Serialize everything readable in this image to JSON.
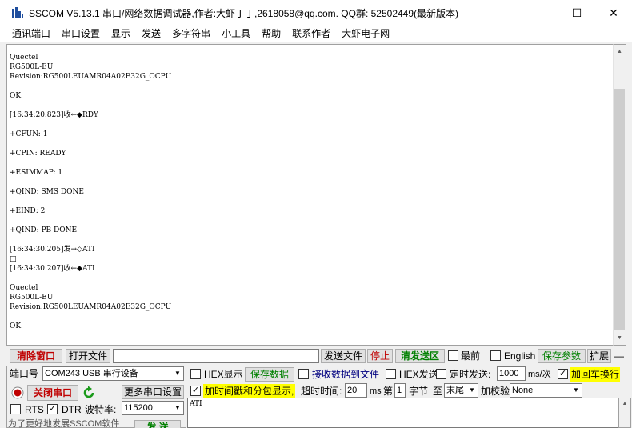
{
  "window": {
    "title": "SSCOM V5.13.1 串口/网络数据调试器,作者:大虾丁丁,2618058@qq.com. QQ群: 52502449(最新版本)",
    "minimize": "—",
    "maximize": "☐",
    "close": "✕"
  },
  "menu": [
    "通讯端口",
    "串口设置",
    "显示",
    "发送",
    "多字符串",
    "小工具",
    "帮助",
    "联系作者",
    "大虾电子网"
  ],
  "receive": {
    "lines": [
      "Quectel",
      "RG500L-EU",
      "Revision:RG500LEUAMR04A02E32G_OCPU",
      "",
      "OK",
      "",
      "[16:34:20.823]收←◆RDY",
      "",
      "+CFUN: 1",
      "",
      "+CPIN: READY",
      "",
      "+ESIMMAP: 1",
      "",
      "+QIND: SMS DONE",
      "",
      "+EIND: 2",
      "",
      "+QIND: PB DONE",
      "",
      "[16:34:30.205]发→◇ATI",
      "□",
      "[16:34:30.207]收←◆ATI",
      "",
      "Quectel",
      "RG500L-EU",
      "Revision:RG500LEUAMR04A02E32G_OCPU",
      "",
      "OK"
    ]
  },
  "toolbar": {
    "clear_window": "清除窗口",
    "open_file": "打开文件",
    "send_file": "发送文件",
    "stop": "停止",
    "clear_send": "清发送区",
    "latest": "最前",
    "english": "English",
    "save_params": "保存参数",
    "expand": "扩展",
    "dash": "—"
  },
  "port": {
    "port_label": "端口号",
    "port_value": "COM243 USB 串行设备",
    "close_port": "关闭串口",
    "more_settings": "更多串口设置",
    "rts": "RTS",
    "dtr": "DTR",
    "baud_label": "波特率:",
    "baud_value": "115200"
  },
  "options": {
    "hex_display": "HEX显示",
    "save_data": "保存数据",
    "recv_to_file": "接收数据到文件",
    "hex_send": "HEX发送",
    "timed_send": "定时发送:",
    "interval": "1000",
    "interval_unit": "ms/次",
    "add_crlf": "加回车换行",
    "timestamp": "加时间戳和分包显示,",
    "timeout_label": "超时时间:",
    "timeout_value": "20",
    "ms": "ms",
    "byte_prefix": "第",
    "byte_value": "1",
    "byte_suffix": "字节",
    "to": "至",
    "end_value": "末尾",
    "checksum_label": "加校验",
    "checksum_value": "None"
  },
  "send": {
    "text": "ATI",
    "send_button": "发 送"
  },
  "footer": {
    "promo": "为了更好地发展SSCOM软件"
  },
  "colors": {
    "accent_red": "#c00000",
    "accent_green": "#008000",
    "highlight_yellow": "#ffff00"
  }
}
